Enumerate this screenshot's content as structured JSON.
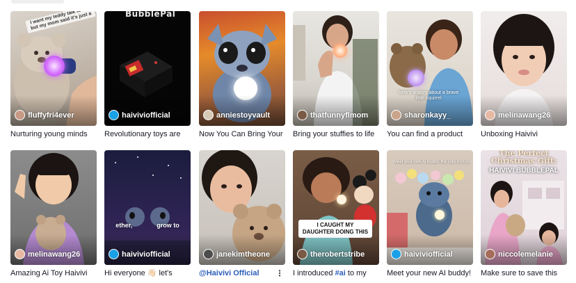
{
  "videos": [
    {
      "handle": "fluffyfri4ever",
      "caption": "Nurturing young minds",
      "overlay": "I want my teddy talk to me but my mom said it's just a"
    },
    {
      "handle": "haiviviofficial",
      "caption": "Revolutionary toys are",
      "overlay": "BubblePal"
    },
    {
      "handle": "anniestoyvault",
      "caption": "Now You Can Bring Your"
    },
    {
      "handle": "thatfunnyflmom",
      "caption": "Bring your stuffies to life"
    },
    {
      "handle": "sharonkayy_",
      "caption": "You can find a product",
      "overlay": "here's a story about a brave little squirrel"
    },
    {
      "handle": "melinawang26",
      "caption": "Unboxing Haivivi"
    },
    {
      "handle": "melinawang26",
      "caption": "Amazing Ai Toy Haivivi"
    },
    {
      "handle": "haiviviofficial",
      "caption": "Hi everyone 👋🏻 let's",
      "overlay": "ether,              grow to"
    },
    {
      "handle": "janekimtheone",
      "caption": "@Haivivi Official"
    },
    {
      "handle": "therobertstribe",
      "caption_prefix": "I introduced ",
      "caption_tag": "#ai",
      "caption_suffix": " to my",
      "overlay": "I CAUGHT MY DAUGHTER DOING THIS"
    },
    {
      "handle": "haiviviofficial",
      "caption": "Meet your new AI buddy!",
      "overlay": "Meet your new AI buddy: the cute toys now"
    },
    {
      "handle": "niccolemelanie",
      "caption": "Make sure to save this",
      "overlay_1": "The Perfect Christmas Gift:",
      "overlay_2": "HAIVIVI BUBBLEPAL"
    }
  ],
  "colors": {
    "text": "#161823",
    "link": "#2b5db9",
    "accent_glow": "#d46cff"
  },
  "icons": {
    "more": "more-icon"
  }
}
